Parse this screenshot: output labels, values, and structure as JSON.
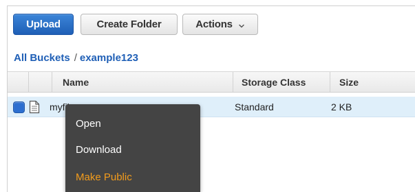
{
  "toolbar": {
    "upload_label": "Upload",
    "create_folder_label": "Create Folder",
    "actions_label": "Actions"
  },
  "breadcrumb": {
    "root": "All Buckets",
    "separator": "/",
    "bucket": "example123"
  },
  "table": {
    "columns": [
      "Name",
      "Storage Class",
      "Size"
    ],
    "rows": [
      {
        "name": "myfil",
        "storage_class": "Standard",
        "size": "2 KB",
        "selected": true,
        "icon": "file-icon"
      }
    ]
  },
  "context_menu": {
    "items": [
      {
        "label": "Open"
      },
      {
        "label": "Download"
      },
      {
        "label": "Make Public",
        "color": "#f39c1c"
      }
    ]
  },
  "colors": {
    "primary_button": "#1f5fb6",
    "link": "#1f5fb6",
    "selected_row": "#dfeffa",
    "menu_bg": "#444444",
    "menu_highlight": "#f39c1c"
  }
}
